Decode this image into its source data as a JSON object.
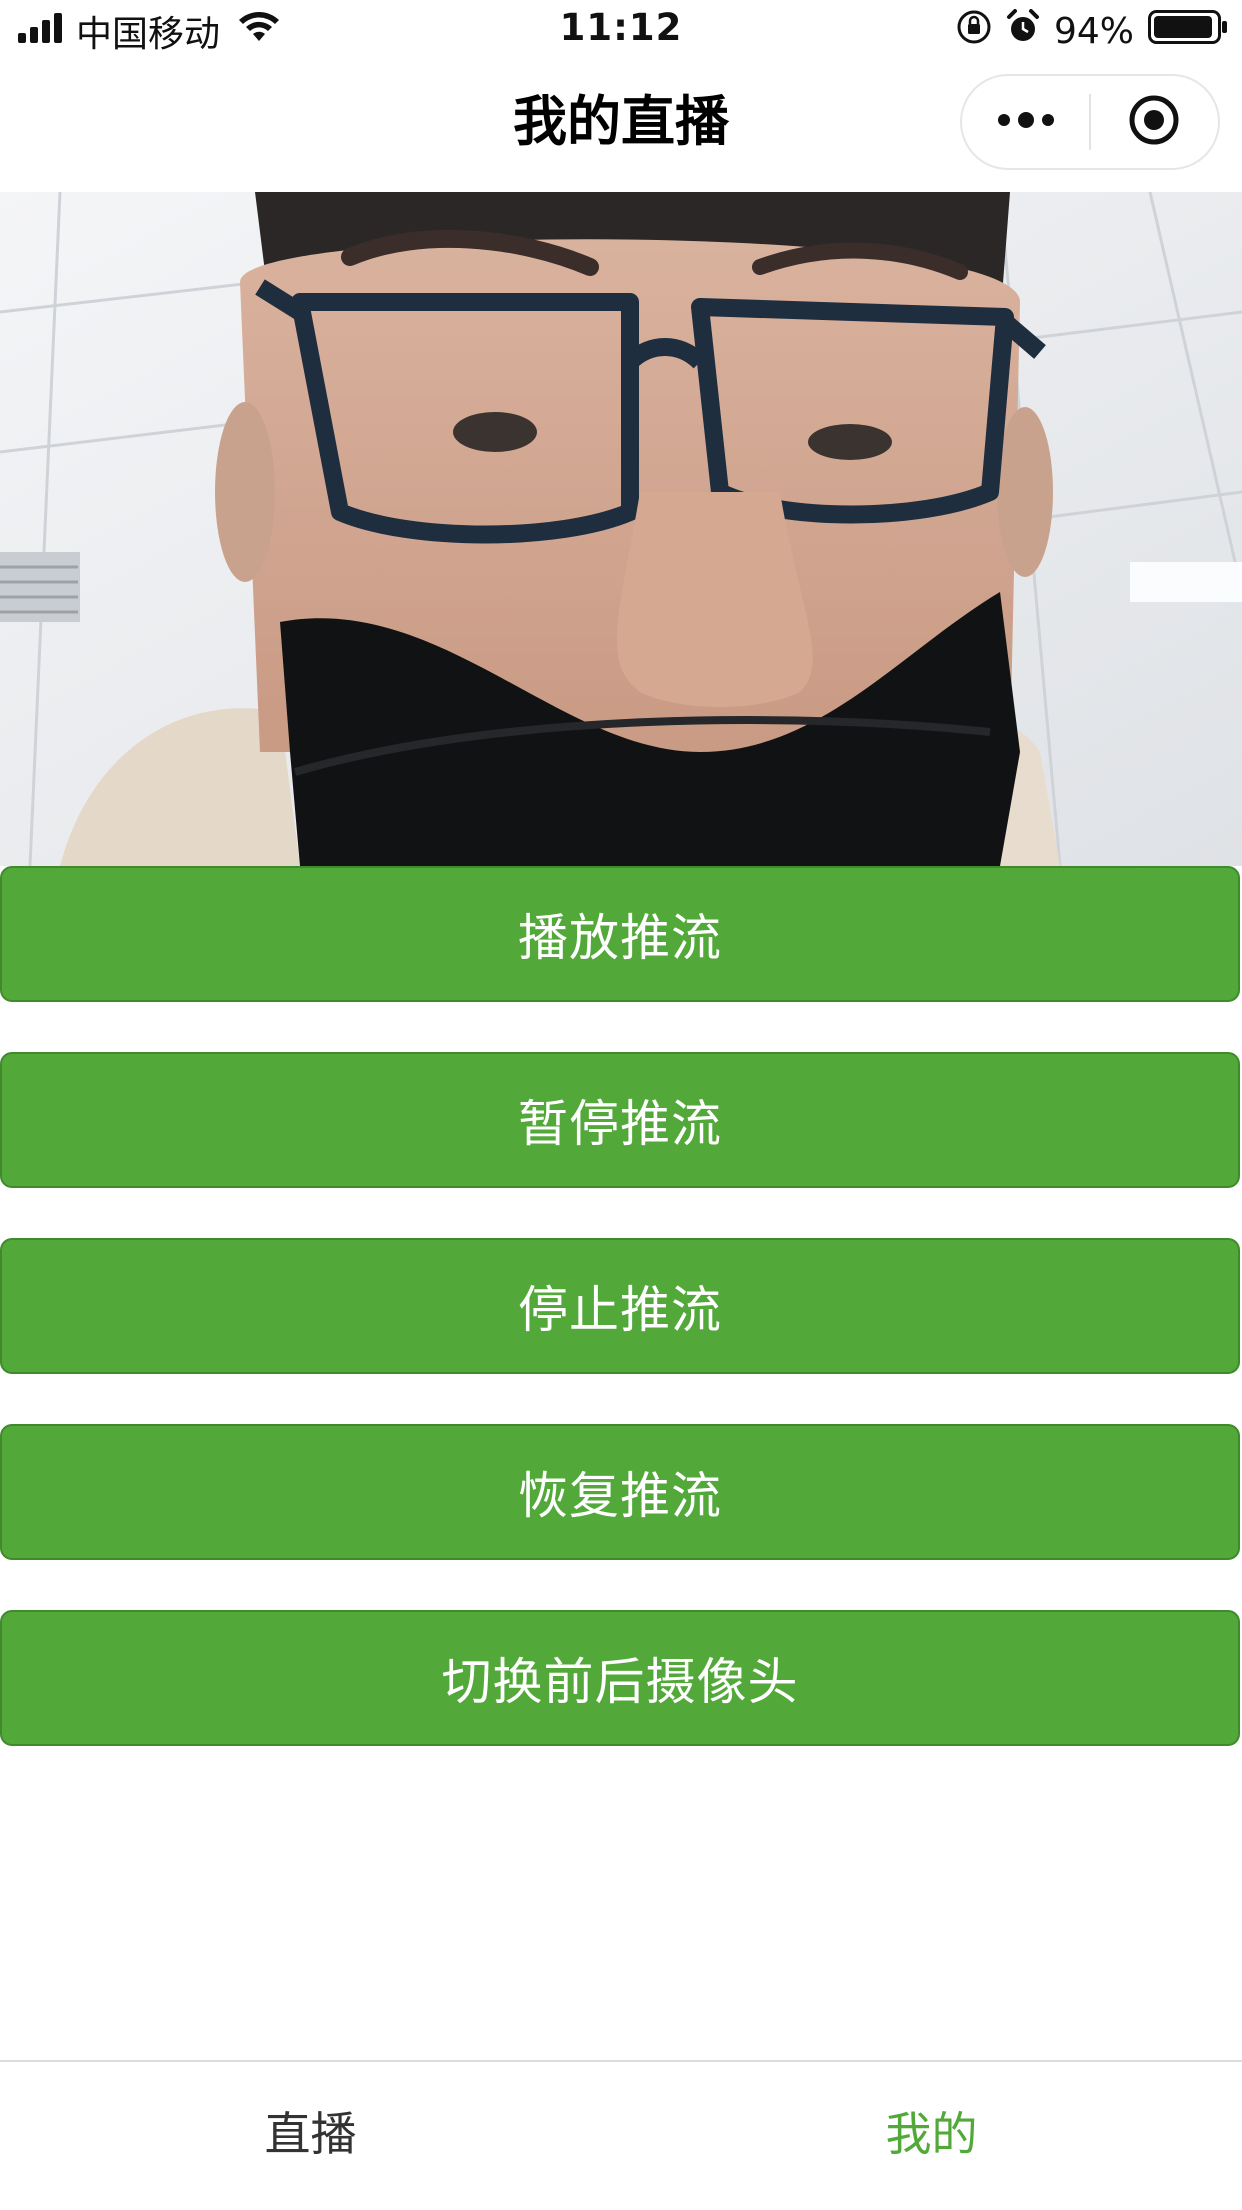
{
  "status_bar": {
    "carrier": "中国移动",
    "time": "11:12",
    "battery": "94%",
    "battery_level": 0.94,
    "icons": [
      "signal-icon",
      "wifi-icon",
      "rotation-lock-icon",
      "alarm-icon",
      "battery-icon"
    ]
  },
  "nav": {
    "title": "我的直播",
    "capsule_icons": [
      "more-icon",
      "close-miniprogram-icon"
    ]
  },
  "preview": {
    "icon": "camera-preview-image"
  },
  "buttons": [
    {
      "label": "播放推流"
    },
    {
      "label": "暂停推流"
    },
    {
      "label": "停止推流"
    },
    {
      "label": "恢复推流"
    },
    {
      "label": "切换前后摄像头"
    }
  ],
  "tabs": [
    {
      "label": "直播",
      "active": false
    },
    {
      "label": "我的",
      "active": true
    }
  ],
  "colors": {
    "accent": "#52a93a",
    "tab_active": "#52a93a",
    "tab_inactive": "#333333"
  }
}
